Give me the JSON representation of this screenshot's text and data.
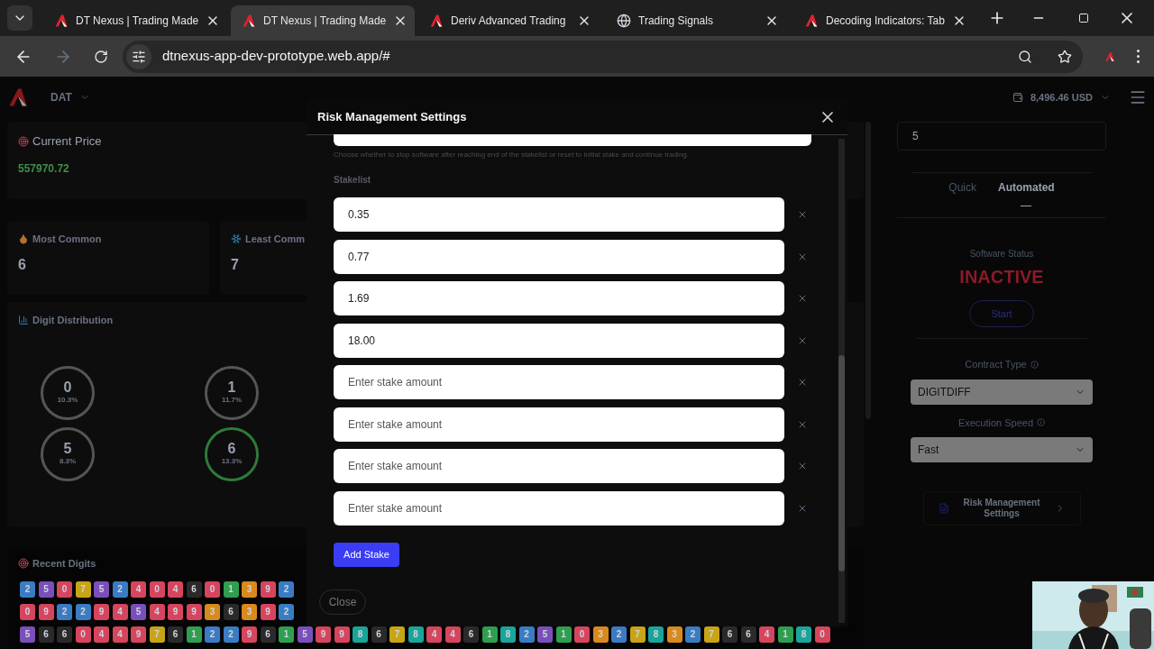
{
  "browser": {
    "tabs": [
      {
        "title": "DT Nexus | Trading Made",
        "selected": false,
        "kind": "app"
      },
      {
        "title": "DT Nexus | Trading Made",
        "selected": true,
        "kind": "app"
      },
      {
        "title": "Deriv Advanced Trading",
        "selected": false,
        "kind": "app"
      },
      {
        "title": "Trading Signals",
        "selected": false,
        "kind": "globe"
      },
      {
        "title": "Decoding Indicators: Tab",
        "selected": false,
        "kind": "app"
      }
    ],
    "url": "dtnexus-app-dev-prototype.web.app/#"
  },
  "app": {
    "brand": "DAT",
    "balance": "8,496.46 USD"
  },
  "current_price": {
    "label": "Current Price",
    "value": "557970.72"
  },
  "most_common": {
    "label": "Most Common",
    "value": "6"
  },
  "least_common": {
    "label": "Least Comm",
    "value": "7"
  },
  "digit_distribution": {
    "title": "Digit Distribution",
    "items": [
      {
        "digit": "0",
        "percent": "10.3%",
        "highlighted": false
      },
      {
        "digit": "1",
        "percent": "11.7%",
        "highlighted": false
      },
      {
        "digit": "5",
        "percent": "8.3%",
        "highlighted": false
      },
      {
        "digit": "6",
        "percent": "13.3%",
        "highlighted": true
      }
    ]
  },
  "recent_digits": {
    "title": "Recent Digits",
    "rows": [
      [
        {
          "digit": "2",
          "color": "#3a7cc4"
        },
        {
          "digit": "5",
          "color": "#7b4fbb"
        },
        {
          "digit": "0",
          "color": "#d6455e"
        },
        {
          "digit": "7",
          "color": "#c8a417"
        },
        {
          "digit": "5",
          "color": "#7b4fbb"
        },
        {
          "digit": "2",
          "color": "#3a7cc4"
        },
        {
          "digit": "4",
          "color": "#d6455e"
        },
        {
          "digit": "0",
          "color": "#d6455e"
        },
        {
          "digit": "4",
          "color": "#d6455e"
        },
        {
          "digit": "6",
          "color": "#2a2a2a"
        },
        {
          "digit": "0",
          "color": "#d6455e"
        },
        {
          "digit": "1",
          "color": "#2f9e4f"
        },
        {
          "digit": "3",
          "color": "#d98a1c"
        },
        {
          "digit": "9",
          "color": "#d6455e"
        },
        {
          "digit": "2",
          "color": "#3a7cc4"
        }
      ],
      [
        {
          "digit": "0",
          "color": "#d6455e"
        },
        {
          "digit": "9",
          "color": "#d6455e"
        },
        {
          "digit": "2",
          "color": "#3a7cc4"
        },
        {
          "digit": "2",
          "color": "#3a7cc4"
        },
        {
          "digit": "9",
          "color": "#d6455e"
        },
        {
          "digit": "4",
          "color": "#d6455e"
        },
        {
          "digit": "5",
          "color": "#7b4fbb"
        },
        {
          "digit": "4",
          "color": "#d6455e"
        },
        {
          "digit": "9",
          "color": "#d6455e"
        },
        {
          "digit": "9",
          "color": "#d6455e"
        },
        {
          "digit": "3",
          "color": "#d98a1c"
        },
        {
          "digit": "6",
          "color": "#2a2a2a"
        },
        {
          "digit": "3",
          "color": "#d98a1c"
        },
        {
          "digit": "9",
          "color": "#d6455e"
        },
        {
          "digit": "2",
          "color": "#3a7cc4"
        }
      ],
      [
        {
          "digit": "5",
          "color": "#7b4fbb"
        },
        {
          "digit": "6",
          "color": "#2a2a2a"
        },
        {
          "digit": "6",
          "color": "#2a2a2a"
        },
        {
          "digit": "0",
          "color": "#d6455e"
        },
        {
          "digit": "4",
          "color": "#d6455e"
        },
        {
          "digit": "4",
          "color": "#d6455e"
        },
        {
          "digit": "9",
          "color": "#d6455e"
        },
        {
          "digit": "7",
          "color": "#c8a417"
        },
        {
          "digit": "6",
          "color": "#2a2a2a"
        },
        {
          "digit": "1",
          "color": "#2f9e4f"
        },
        {
          "digit": "2",
          "color": "#3a7cc4"
        },
        {
          "digit": "2",
          "color": "#3a7cc4"
        },
        {
          "digit": "9",
          "color": "#d6455e"
        },
        {
          "digit": "6",
          "color": "#2a2a2a"
        },
        {
          "digit": "1",
          "color": "#2f9e4f"
        },
        {
          "digit": "5",
          "color": "#7b4fbb"
        },
        {
          "digit": "9",
          "color": "#d6455e"
        },
        {
          "digit": "9",
          "color": "#d6455e"
        },
        {
          "digit": "8",
          "color": "#1aa59a"
        },
        {
          "digit": "6",
          "color": "#2a2a2a"
        },
        {
          "digit": "7",
          "color": "#c8a417"
        },
        {
          "digit": "8",
          "color": "#1aa59a"
        },
        {
          "digit": "4",
          "color": "#d6455e"
        },
        {
          "digit": "4",
          "color": "#d6455e"
        },
        {
          "digit": "6",
          "color": "#2a2a2a"
        },
        {
          "digit": "1",
          "color": "#2f9e4f"
        },
        {
          "digit": "8",
          "color": "#1aa59a"
        },
        {
          "digit": "2",
          "color": "#3a7cc4"
        },
        {
          "digit": "5",
          "color": "#7b4fbb"
        },
        {
          "digit": "1",
          "color": "#2f9e4f"
        },
        {
          "digit": "0",
          "color": "#d6455e"
        },
        {
          "digit": "3",
          "color": "#d98a1c"
        },
        {
          "digit": "2",
          "color": "#3a7cc4"
        },
        {
          "digit": "7",
          "color": "#c8a417"
        },
        {
          "digit": "8",
          "color": "#1aa59a"
        },
        {
          "digit": "3",
          "color": "#d98a1c"
        },
        {
          "digit": "2",
          "color": "#3a7cc4"
        },
        {
          "digit": "7",
          "color": "#c8a417"
        },
        {
          "digit": "6",
          "color": "#2a2a2a"
        },
        {
          "digit": "6",
          "color": "#2a2a2a"
        },
        {
          "digit": "4",
          "color": "#d6455e"
        },
        {
          "digit": "1",
          "color": "#2f9e4f"
        },
        {
          "digit": "8",
          "color": "#1aa59a"
        },
        {
          "digit": "0",
          "color": "#d6455e"
        }
      ]
    ]
  },
  "right_panel": {
    "field_value": "5",
    "tabs": [
      {
        "label": "Quick",
        "selected": false
      },
      {
        "label": "Automated",
        "selected": true
      }
    ],
    "status_label": "Software Status",
    "status": "INACTIVE",
    "start_button": "Start",
    "contract_type": {
      "label": "Contract Type",
      "value": "DIGITDIFF"
    },
    "execution_speed": {
      "label": "Execution Speed",
      "value": "Fast"
    },
    "risk_button": "Risk Management Settings"
  },
  "modal": {
    "title": "Risk Management Settings",
    "hint": "Choose whether to stop software after reaching end of the stakelist or reset to initial stake and continue trading.",
    "stakelist_label": "Stakelist",
    "stakes": [
      {
        "value": "0.35"
      },
      {
        "value": "0.77"
      },
      {
        "value": "1.69"
      },
      {
        "value": "18.00"
      },
      {
        "placeholder": "Enter stake amount"
      },
      {
        "placeholder": "Enter stake amount"
      },
      {
        "placeholder": "Enter stake amount"
      },
      {
        "placeholder": "Enter stake amount"
      }
    ],
    "add_button": "Add Stake",
    "close_button": "Close"
  }
}
